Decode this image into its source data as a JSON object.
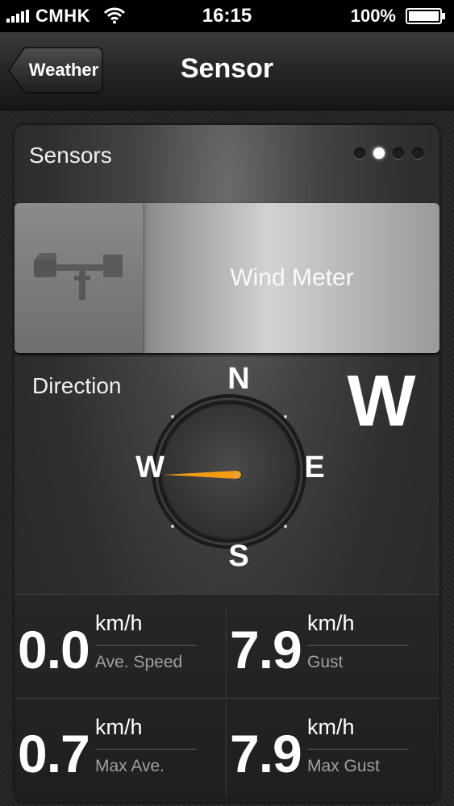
{
  "status_bar": {
    "carrier": "CMHK",
    "time": "16:15",
    "battery": "100%"
  },
  "nav": {
    "back_label": "Weather",
    "title": "Sensor"
  },
  "card": {
    "title": "Sensors",
    "page_count": 4,
    "active_page": 2,
    "sensor_name": "Wind Meter"
  },
  "direction": {
    "label": "Direction",
    "value": "W",
    "cardinals": {
      "n": "N",
      "e": "E",
      "s": "S",
      "w": "W"
    },
    "needle_color": "#f39c12"
  },
  "stats": [
    {
      "value": "0.0",
      "unit": "km/h",
      "label": "Ave. Speed"
    },
    {
      "value": "7.9",
      "unit": "km/h",
      "label": "Gust"
    },
    {
      "value": "0.7",
      "unit": "km/h",
      "label": "Max Ave."
    },
    {
      "value": "7.9",
      "unit": "km/h",
      "label": "Max Gust"
    }
  ]
}
